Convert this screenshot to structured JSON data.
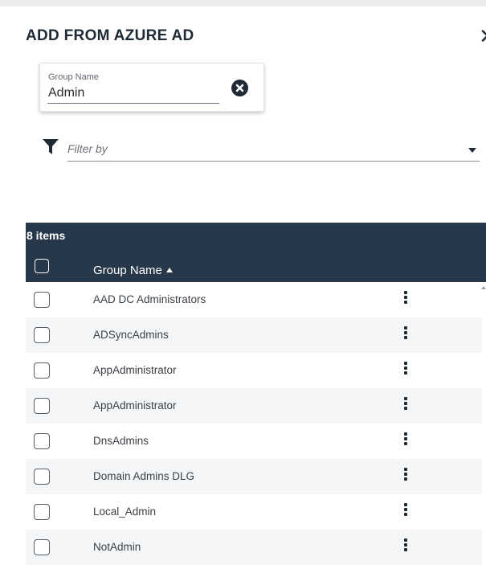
{
  "dialog": {
    "title": "ADD FROM AZURE AD",
    "close_icon": "close-icon"
  },
  "search": {
    "label": "Group Name",
    "value": "Admin",
    "clear_icon": "clear-circle-icon"
  },
  "filter": {
    "placeholder": "Filter by",
    "icon": "funnel-icon"
  },
  "grid": {
    "count_label": "8 items",
    "column_header": "Group Name",
    "sort": "ascending",
    "header_color": "#27384a",
    "rows": [
      {
        "name": "AAD DC Administrators"
      },
      {
        "name": "ADSyncAdmins"
      },
      {
        "name": "AppAdministrator"
      },
      {
        "name": "AppAdministrator"
      },
      {
        "name": "DnsAdmins"
      },
      {
        "name": "Domain Admins DLG"
      },
      {
        "name": "Local_Admin"
      },
      {
        "name": "NotAdmin"
      }
    ]
  }
}
